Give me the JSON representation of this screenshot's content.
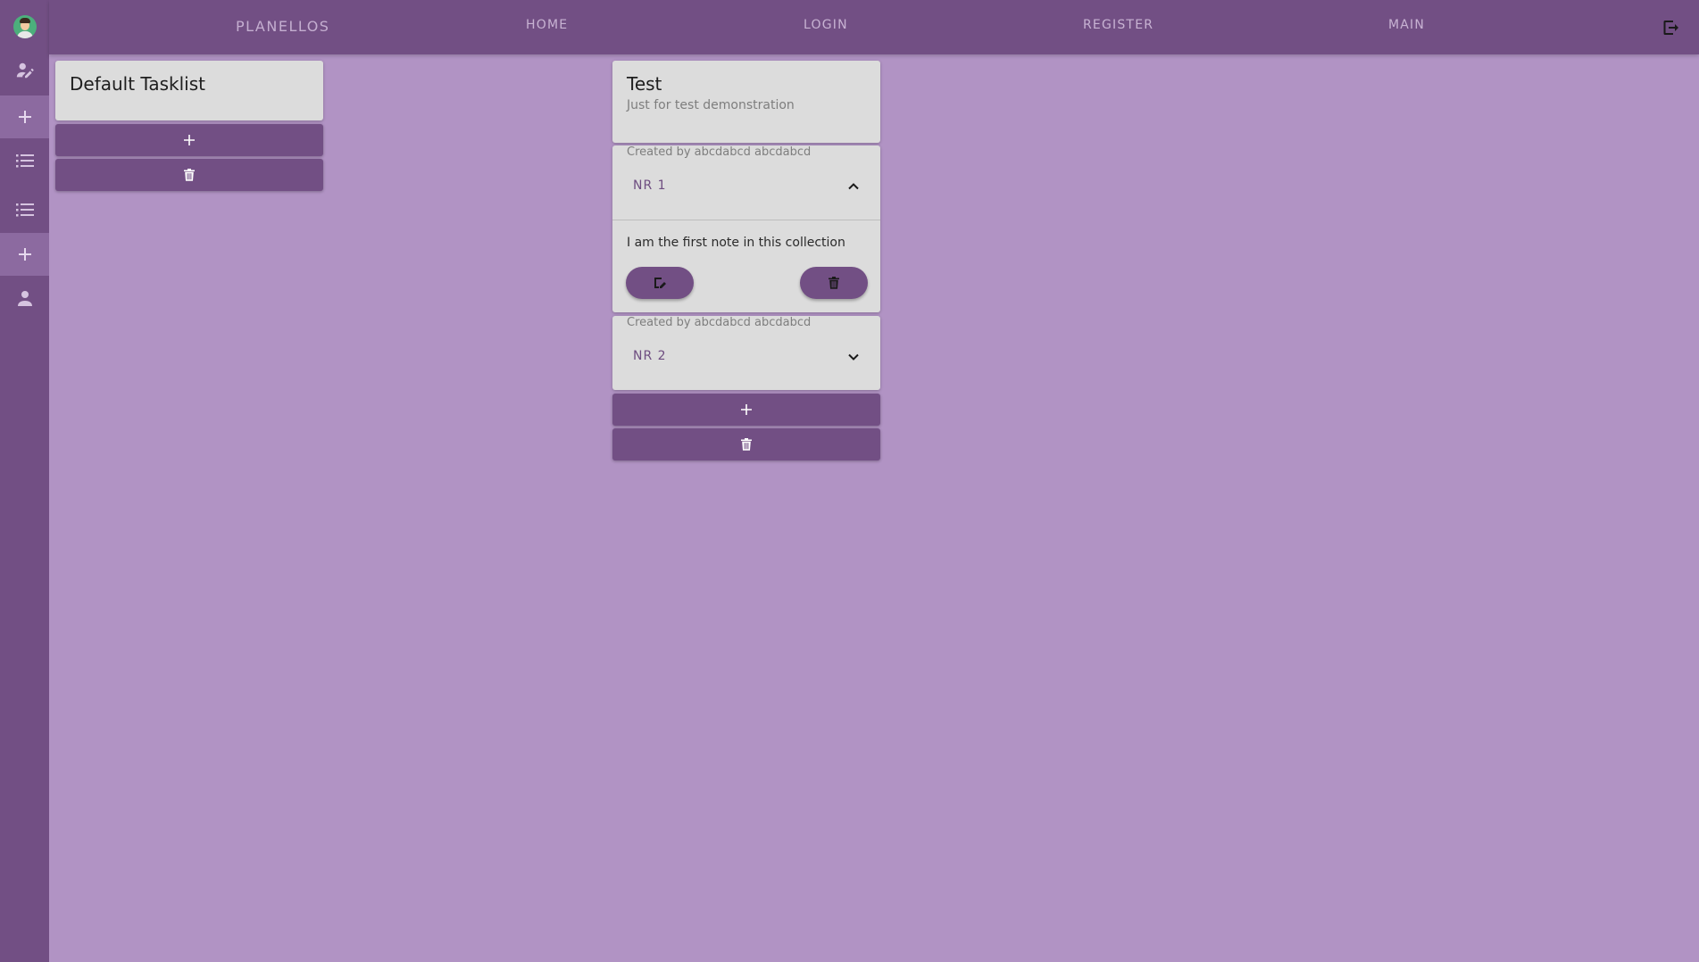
{
  "app": {
    "brand": "PLANELLOS"
  },
  "topnav": {
    "home": "HOME",
    "login": "LOGIN",
    "register": "REGISTER",
    "main": "MAIN"
  },
  "sidebar": {
    "items": [
      {
        "name": "avatar"
      },
      {
        "name": "edit-user-icon"
      },
      {
        "name": "add-icon",
        "active": true
      },
      {
        "name": "list-icon"
      },
      {
        "name": "list-icon"
      },
      {
        "name": "add-icon",
        "active": true
      },
      {
        "name": "person-icon"
      }
    ]
  },
  "tasklists": [
    {
      "title": "Default Tasklist",
      "subtitle": ""
    },
    {
      "title": "Test",
      "subtitle": "Just for test demonstration",
      "notes": [
        {
          "created": "Created by abcdabcd abcdabcd",
          "title": "NR 1",
          "expanded": true,
          "body": "I am the first note in this collection"
        },
        {
          "created": "Created by abcdabcd abcdabcd",
          "title": "NR 2",
          "expanded": false,
          "body": ""
        }
      ]
    }
  ],
  "colors": {
    "background": "#b193c4",
    "bar": "#724f84",
    "card": "#dcdcdc",
    "accent_text": "#6e4d80"
  },
  "icons": {
    "add": "plus-icon",
    "delete": "trash-icon",
    "edit": "edit-note-icon",
    "logout": "logout-icon"
  }
}
